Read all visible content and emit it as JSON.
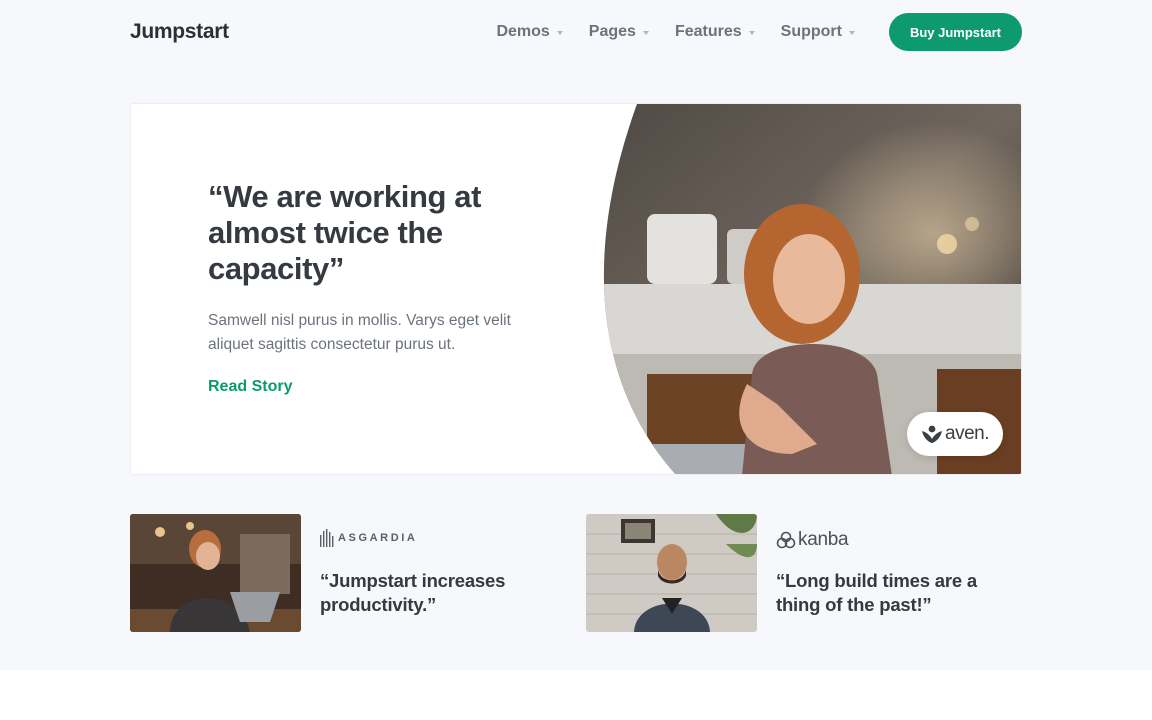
{
  "header": {
    "brand": "Jumpstart",
    "nav": [
      {
        "label": "Demos"
      },
      {
        "label": "Pages"
      },
      {
        "label": "Features"
      },
      {
        "label": "Support"
      }
    ],
    "cta_label": "Buy Jumpstart"
  },
  "hero": {
    "quote": "“We are working at almost twice the capacity”",
    "description": "Samwell nisl purus in mollis. Varys eget velit aliquet sagittis consectetur purus ut.",
    "link_label": "Read Story",
    "badge_brand": "aven."
  },
  "testimonials": [
    {
      "company": "ASGARDIA",
      "quote": "“Jumpstart increases productivity.”"
    },
    {
      "company": "kanba",
      "quote": "“Long build times are a thing of the past!”"
    }
  ],
  "colors": {
    "accent": "#0d9a6e",
    "section_background": "#f7f8fc",
    "heading": "#343a40",
    "muted": "#6c737d"
  },
  "icons": {
    "nav_caret": "chevron-down-icon",
    "aven_logo": "aven-logo-icon",
    "asgardia_logo": "asgardia-bars-icon",
    "kanba_logo": "kanba-rings-icon"
  }
}
